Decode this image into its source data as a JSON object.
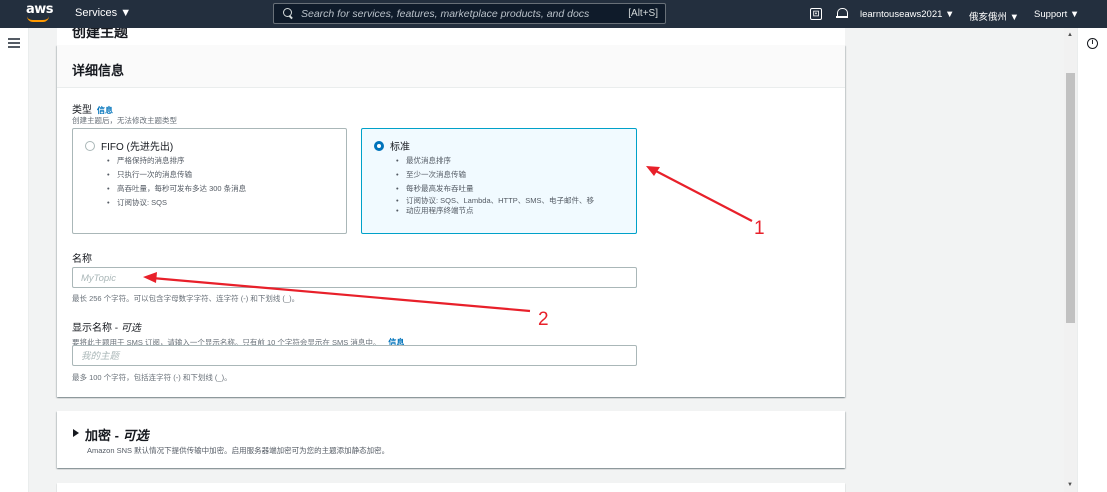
{
  "topnav": {
    "logo_text": "aws",
    "services_label": "Services ▼",
    "search_placeholder": "Search for services, features, marketplace products, and docs",
    "search_shortcut": "[Alt+S]",
    "account_label": "learntouseaws2021 ▼",
    "region_label": "俄亥俄州 ▼",
    "support_label": "Support ▼",
    "cloudshell_glyph": "⊡"
  },
  "page": {
    "partial_heading": "创建主题"
  },
  "details": {
    "header": "详细信息",
    "type_label": "类型",
    "type_info": "信息",
    "type_desc": "创建主题后，无法修改主题类型",
    "options": [
      {
        "title": "FIFO (先进先出)",
        "selected": false,
        "bullets": [
          "严格保持的消息排序",
          "只执行一次的消息传输",
          "高吞吐量，每秒可发布多达 300 条消息",
          "订阅协议: SQS"
        ]
      },
      {
        "title": "标准",
        "selected": true,
        "bullets": [
          "最优消息排序",
          "至少一次消息传输",
          "每秒最高发布吞吐量",
          "订阅协议: SQS、Lambda、HTTP、SMS、电子邮件、移",
          "动应用程序终端节点"
        ]
      }
    ],
    "name_label": "名称",
    "name_placeholder": "MyTopic",
    "name_hint": "最长 256 个字符。可以包含字母数字字符、连字符 (-) 和下划线 (_)。",
    "display_label": "显示名称 - ",
    "display_optional": "可选",
    "display_desc": "要将此主题用于 SMS 订阅，请输入一个显示名称。只有前 10 个字符会显示在 SMS 消息中。",
    "display_info": "信息",
    "display_placeholder": "我的主题",
    "display_hint": "最多 100 个字符，包括连字符 (-) 和下划线 (_)。"
  },
  "encryption": {
    "title": "加密 - ",
    "optional": "可选",
    "desc": "Amazon SNS 默认情况下提供传输中加密。启用服务器端加密可为您的主题添加静态加密。"
  },
  "annotations": {
    "label_1": "1",
    "label_2": "2",
    "color": "#e8202a"
  }
}
